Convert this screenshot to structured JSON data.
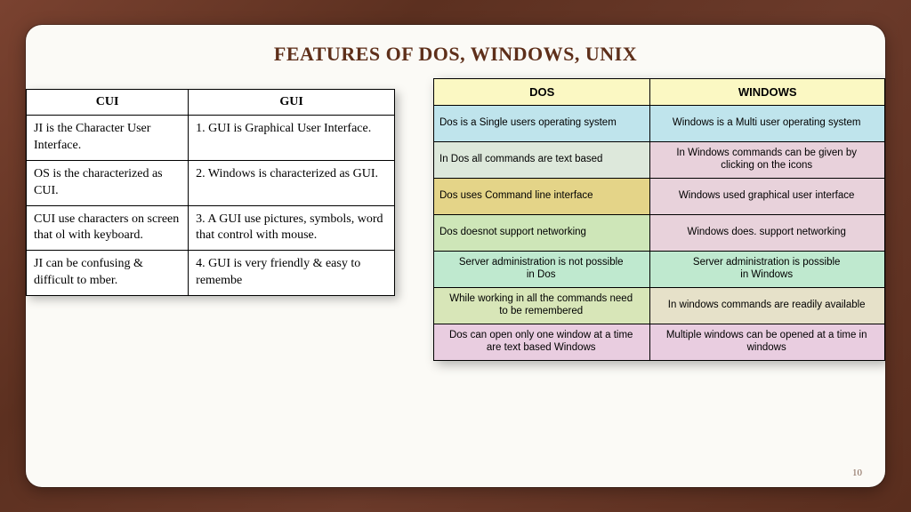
{
  "title": "FEATURES OF DOS, WINDOWS, UNIX",
  "page_number": "10",
  "cui_gui_table": {
    "headers": [
      "CUI",
      "GUI"
    ],
    "rows": [
      {
        "cui": "JI is the Character User Interface.",
        "gui": "1. GUI is Graphical User Interface."
      },
      {
        "cui": "OS is the characterized as CUI.",
        "gui": "2. Windows is characterized as GUI."
      },
      {
        "cui": "CUI use characters on screen that ol with keyboard.",
        "gui": "3. A GUI use pictures, symbols, word that control with mouse."
      },
      {
        "cui": "JI can be confusing & difficult to mber.",
        "gui": "4. GUI is very friendly & easy to remembe"
      }
    ]
  },
  "dos_win_table": {
    "headers": [
      "DOS",
      "WINDOWS"
    ],
    "rows": [
      {
        "dos": "Dos is a Single users operating system",
        "win": "Windows  is a Multi user  operating system"
      },
      {
        "dos": "In Dos all commands are text based",
        "win": "In  Windows commands  can be given by",
        "win_sub": "clicking on the icons"
      },
      {
        "dos": "Dos uses Command line  interface",
        "win": "Windows  used   graphical user  interface"
      },
      {
        "dos": "Dos doesnot support networking",
        "win": "Windows  does. support networking"
      },
      {
        "dos": "Server administration is not possible",
        "dos_sub": "in Dos",
        "win": "Server administration is  possible",
        "win_sub": "in Windows"
      },
      {
        "dos": "While working in all the commands need",
        "dos_sub": "to be remembered",
        "win": "In windows  commands are readily available"
      },
      {
        "dos": "Dos can open only one window at a time",
        "dos_sub": "are text based Windows",
        "win": "Multiple  windows  can be opened at a time in",
        "win_sub": "windows"
      }
    ]
  },
  "chart_data": [
    {
      "type": "table",
      "title": "CUI vs GUI",
      "columns": [
        "CUI",
        "GUI"
      ],
      "rows": [
        [
          "JI is the Character User Interface.",
          "1. GUI is Graphical User Interface."
        ],
        [
          "OS is the characterized as CUI.",
          "2. Windows is characterized as GUI."
        ],
        [
          "CUI use characters on screen that ol with keyboard.",
          "3. A GUI use pictures, symbols, word that control with mouse."
        ],
        [
          "JI can be confusing & difficult to mber.",
          "4. GUI is very friendly & easy to remembe"
        ]
      ]
    },
    {
      "type": "table",
      "title": "DOS vs WINDOWS",
      "columns": [
        "DOS",
        "WINDOWS"
      ],
      "rows": [
        [
          "Dos is a Single users operating system",
          "Windows is a Multi user operating system"
        ],
        [
          "In Dos all commands are text based",
          "In Windows commands can be given by clicking on the icons"
        ],
        [
          "Dos uses Command line interface",
          "Windows used graphical user interface"
        ],
        [
          "Dos doesnot support networking",
          "Windows does. support networking"
        ],
        [
          "Server administration is not possible in Dos",
          "Server administration is possible in Windows"
        ],
        [
          "While working in all the commands need to be remembered",
          "In windows commands are readily available"
        ],
        [
          "Dos can open only one window at a time are text based Windows",
          "Multiple windows can be opened at a time in windows"
        ]
      ]
    }
  ]
}
